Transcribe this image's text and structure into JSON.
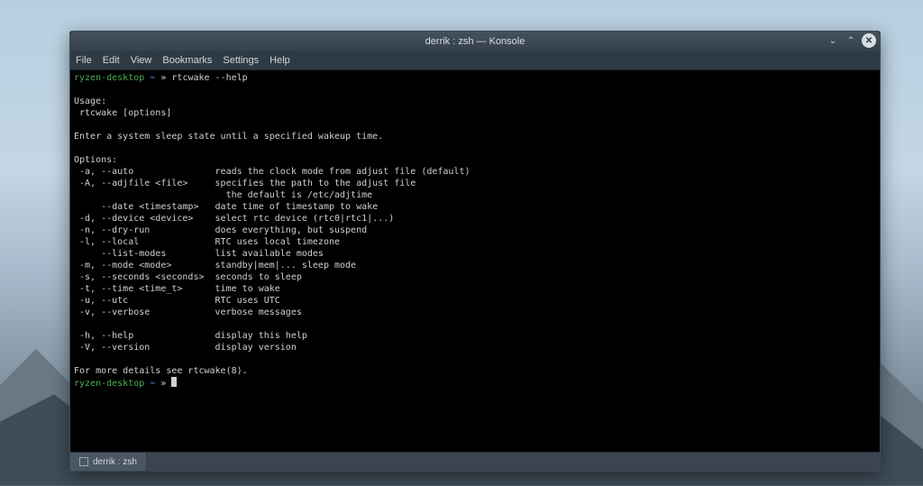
{
  "window": {
    "title": "derrik : zsh — Konsole"
  },
  "menubar": {
    "items": [
      "File",
      "Edit",
      "View",
      "Bookmarks",
      "Settings",
      "Help"
    ]
  },
  "prompt": {
    "host": "ryzen-desktop",
    "path": "~",
    "symbol": "»",
    "command": "rtcwake --help"
  },
  "output": {
    "usage_header": "Usage:",
    "usage_line": " rtcwake [options]",
    "description": "Enter a system sleep state until a specified wakeup time.",
    "options_header": "Options:",
    "options": [
      {
        "flags": " -a, --auto",
        "desc": "reads the clock mode from adjust file (default)"
      },
      {
        "flags": " -A, --adjfile <file>",
        "desc": "specifies the path to the adjust file"
      },
      {
        "flags": "",
        "desc": "  the default is /etc/adjtime"
      },
      {
        "flags": "     --date <timestamp>",
        "desc": "date time of timestamp to wake"
      },
      {
        "flags": " -d, --device <device>",
        "desc": "select rtc device (rtc0|rtc1|...)"
      },
      {
        "flags": " -n, --dry-run",
        "desc": "does everything, but suspend"
      },
      {
        "flags": " -l, --local",
        "desc": "RTC uses local timezone"
      },
      {
        "flags": "     --list-modes",
        "desc": "list available modes"
      },
      {
        "flags": " -m, --mode <mode>",
        "desc": "standby|mem|... sleep mode"
      },
      {
        "flags": " -s, --seconds <seconds>",
        "desc": "seconds to sleep"
      },
      {
        "flags": " -t, --time <time_t>",
        "desc": "time to wake"
      },
      {
        "flags": " -u, --utc",
        "desc": "RTC uses UTC"
      },
      {
        "flags": " -v, --verbose",
        "desc": "verbose messages"
      }
    ],
    "help_options": [
      {
        "flags": " -h, --help",
        "desc": "display this help"
      },
      {
        "flags": " -V, --version",
        "desc": "display version"
      }
    ],
    "footer": "For more details see rtcwake(8)."
  },
  "tab": {
    "label": "derrik : zsh"
  },
  "controls": {
    "min": "⌄",
    "max": "⌃",
    "close": "✕"
  }
}
